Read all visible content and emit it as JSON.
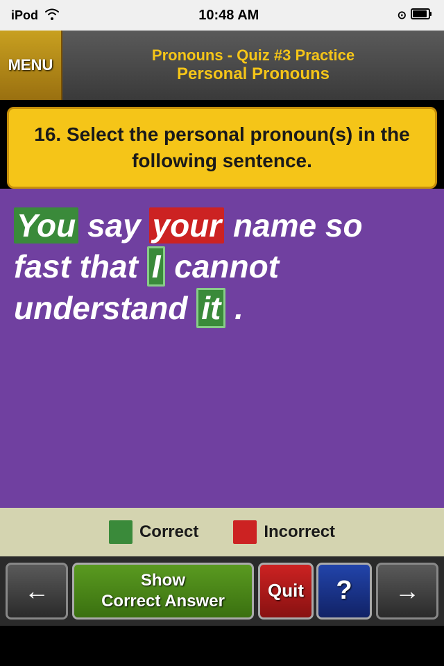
{
  "statusBar": {
    "device": "iPod",
    "time": "10:48 AM",
    "wifiIcon": "wifi-icon",
    "clockIcon": "⊙",
    "batteryIcon": "🔋"
  },
  "header": {
    "menuLabel": "MENU",
    "titleLine1": "Pronouns - Quiz #3 Practice",
    "titleLine2": "Personal Pronouns"
  },
  "question": {
    "text": "16. Select the personal pronoun(s) in the following sentence."
  },
  "sentence": {
    "words": [
      {
        "text": "You",
        "type": "correct"
      },
      {
        "text": " say ",
        "type": "normal"
      },
      {
        "text": "your",
        "type": "incorrect"
      },
      {
        "text": " name so\nfast that ",
        "type": "normal"
      },
      {
        "text": "I",
        "type": "selected-correct"
      },
      {
        "text": " cannot\nunderstand ",
        "type": "normal"
      },
      {
        "text": "it",
        "type": "selected-correct"
      },
      {
        "text": ".",
        "type": "normal"
      }
    ],
    "displayText": "You say your name so fast that I cannot understand it."
  },
  "legend": {
    "correctLabel": "Correct",
    "incorrectLabel": "Incorrect"
  },
  "bottomBar": {
    "prevLabel": "←",
    "showCorrectLabel": "Show\nCorrect Answer",
    "quitLabel": "Quit",
    "helpLabel": "?",
    "nextLabel": "→"
  }
}
